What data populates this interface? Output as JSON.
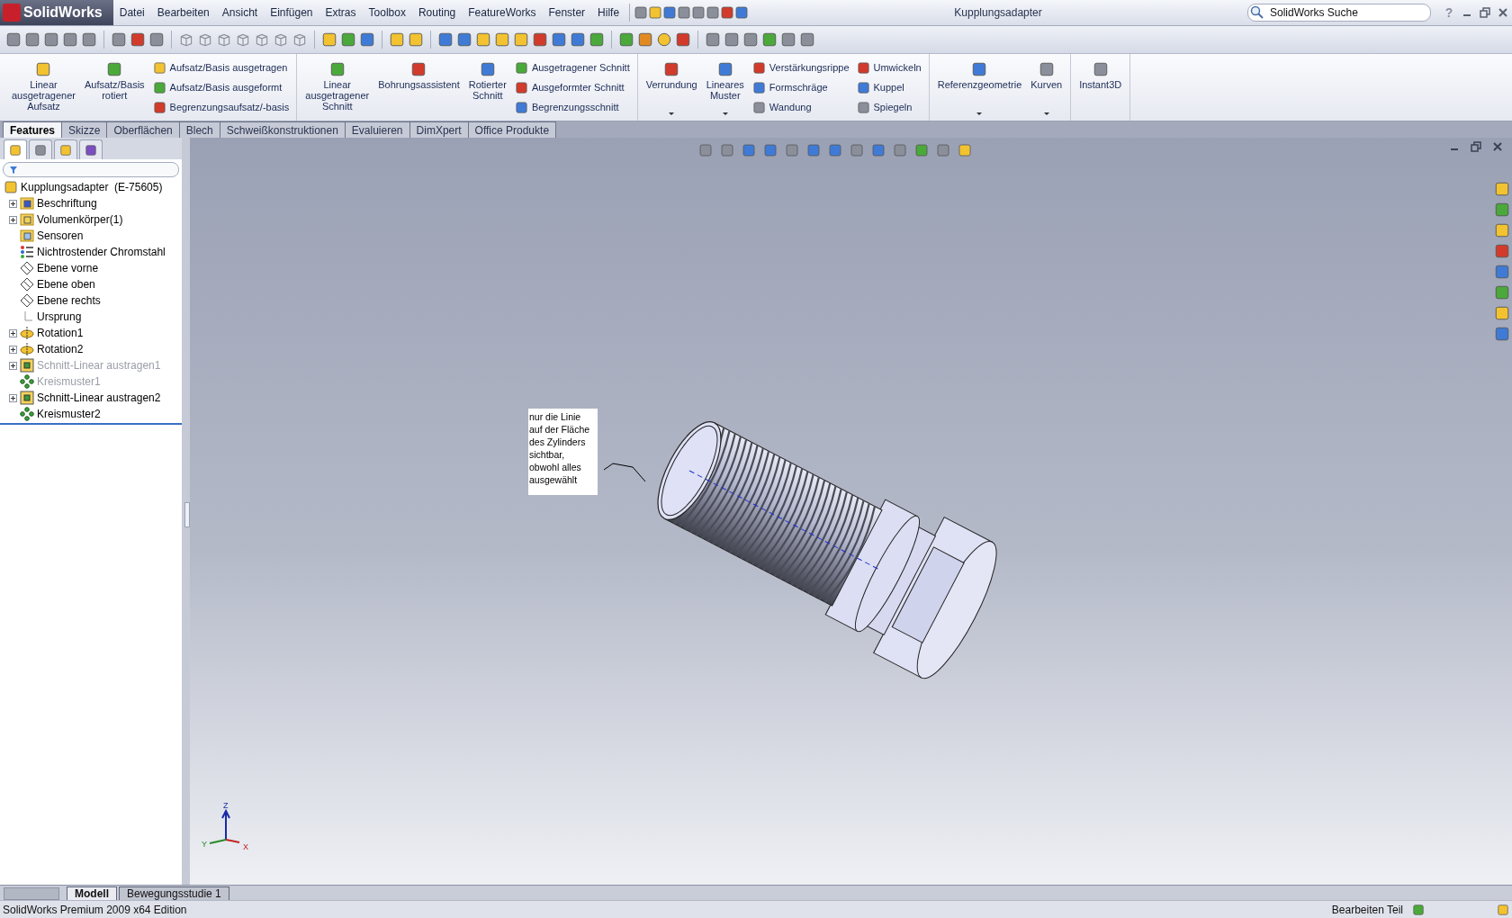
{
  "titlebar": {
    "logo": "SolidWorks",
    "menu": [
      "Datei",
      "Bearbeiten",
      "Ansicht",
      "Einfügen",
      "Extras",
      "Toolbox",
      "Routing",
      "FeatureWorks",
      "Fenster",
      "Hilfe"
    ],
    "document": "Kupplungsadapter",
    "search": {
      "placeholder": "SolidWorks Suche"
    },
    "help": "?"
  },
  "ribbon": [
    {
      "items": [
        {
          "kind": "large",
          "label": "Linear ausgetragener Aufsatz",
          "dropdown": false
        },
        {
          "kind": "large",
          "label": "Aufsatz/Basis rotiert",
          "dropdown": false
        },
        {
          "kind": "stack",
          "entries": [
            "Aufsatz/Basis ausgetragen",
            "Aufsatz/Basis ausgeformt",
            "Begrenzungsaufsatz/-basis"
          ]
        }
      ]
    },
    {
      "items": [
        {
          "kind": "large",
          "label": "Linear ausgetragener Schnitt",
          "dropdown": false
        },
        {
          "kind": "large",
          "label": "Bohrungsassistent",
          "dropdown": false
        },
        {
          "kind": "large",
          "label": "Rotierter Schnitt",
          "dropdown": false
        },
        {
          "kind": "stack",
          "entries": [
            "Ausgetragener Schnitt",
            "Ausgeformter Schnitt",
            "Begrenzungsschnitt"
          ]
        }
      ]
    },
    {
      "items": [
        {
          "kind": "large",
          "label": "Verrundung",
          "dropdown": true
        },
        {
          "kind": "large",
          "label": "Lineares Muster",
          "dropdown": true
        },
        {
          "kind": "stack",
          "entries": [
            "Verstärkungsrippe",
            "Formschräge",
            "Wandung"
          ]
        },
        {
          "kind": "stack",
          "entries": [
            "Umwickeln",
            "Kuppel",
            "Spiegeln"
          ]
        }
      ]
    },
    {
      "items": [
        {
          "kind": "large",
          "label": "Referenzgeometrie",
          "dropdown": true
        },
        {
          "kind": "large",
          "label": "Kurven",
          "dropdown": true
        }
      ]
    },
    {
      "items": [
        {
          "kind": "large",
          "label": "Instant3D",
          "dropdown": false
        }
      ]
    }
  ],
  "command_tabs": [
    {
      "label": "Features",
      "selected": true
    },
    {
      "label": "Skizze",
      "selected": false
    },
    {
      "label": "Oberflächen",
      "selected": false
    },
    {
      "label": "Blech",
      "selected": false
    },
    {
      "label": "Schweißkonstruktionen",
      "selected": false
    },
    {
      "label": "Evaluieren",
      "selected": false
    },
    {
      "label": "DimXpert",
      "selected": false
    },
    {
      "label": "Office Produkte",
      "selected": false
    }
  ],
  "panel_tabs": [
    {
      "selected": true
    },
    {
      "selected": false
    },
    {
      "selected": false
    },
    {
      "selected": false
    }
  ],
  "tree": {
    "root": "Kupplungsadapter  (E-75605)",
    "items": [
      {
        "label": "Beschriftung",
        "kind": "annotations",
        "expandable": true,
        "suppressed": false
      },
      {
        "label": "Volumenkörper(1)",
        "kind": "bodies",
        "expandable": true,
        "suppressed": false
      },
      {
        "label": "Sensoren",
        "kind": "sensors",
        "expandable": false,
        "suppressed": false
      },
      {
        "label": "Nichtrostender Chromstahl",
        "kind": "material",
        "expandable": false,
        "suppressed": false
      },
      {
        "label": "Ebene vorne",
        "kind": "plane",
        "expandable": false,
        "suppressed": false
      },
      {
        "label": "Ebene oben",
        "kind": "plane",
        "expandable": false,
        "suppressed": false
      },
      {
        "label": "Ebene rechts",
        "kind": "plane",
        "expandable": false,
        "suppressed": false
      },
      {
        "label": "Ursprung",
        "kind": "origin",
        "expandable": false,
        "suppressed": false
      },
      {
        "label": "Rotation1",
        "kind": "revolve",
        "expandable": true,
        "suppressed": false
      },
      {
        "label": "Rotation2",
        "kind": "revolve",
        "expandable": true,
        "suppressed": false
      },
      {
        "label": "Schnitt-Linear austragen1",
        "kind": "cut",
        "expandable": true,
        "suppressed": true
      },
      {
        "label": "Kreismuster1",
        "kind": "pattern",
        "expandable": false,
        "suppressed": true
      },
      {
        "label": "Schnitt-Linear austragen2",
        "kind": "cut",
        "expandable": true,
        "suppressed": false
      },
      {
        "label": "Kreismuster2",
        "kind": "pattern",
        "expandable": false,
        "suppressed": false
      }
    ]
  },
  "viewport": {
    "note": "nur die Linie auf der Fläche des Zylinders sichtbar, obwohl alles ausgewählt",
    "triad": {
      "x": "X",
      "y": "Y",
      "z": "Z"
    }
  },
  "bottom_tabs": [
    {
      "label": "Modell",
      "selected": true
    },
    {
      "label": "Bewegungsstudie 1",
      "selected": false
    }
  ],
  "status_bar": {
    "edition": "SolidWorks Premium 2009 x64 Edition",
    "mode": "Bearbeiten Teil"
  }
}
